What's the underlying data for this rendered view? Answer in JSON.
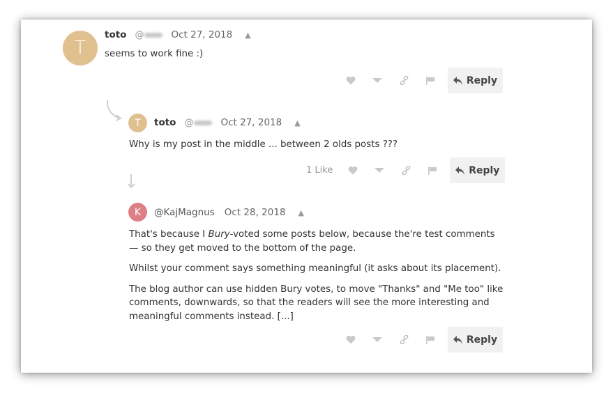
{
  "comments": [
    {
      "avatar_letter": "T",
      "avatar_color": "#e0c08f",
      "username": "toto",
      "handle_prefix": "@",
      "date": "Oct 27, 2018",
      "collapse_icon": "caret-up-icon",
      "body": [
        "seems to work fine :)"
      ],
      "likes": "",
      "reply_label": "Reply"
    },
    {
      "avatar_letter": "T",
      "avatar_color": "#e0c08f",
      "username": "toto",
      "handle_prefix": "@",
      "date": "Oct 27, 2018",
      "collapse_icon": "caret-up-icon",
      "body": [
        "Why is my post in the middle ... between 2 olds posts ???"
      ],
      "likes": "1 Like",
      "reply_label": "Reply"
    },
    {
      "avatar_letter": "K",
      "avatar_color": "#de7f85",
      "username": "@KajMagnus",
      "date": "Oct 28, 2018",
      "collapse_icon": "caret-up-icon",
      "body_p1_before": "That's because I ",
      "body_p1_em": "Bury",
      "body_p1_after": "-voted some posts below, because the're test comments — so they get moved to the bottom of the page.",
      "body_p2": "Whilst your comment says something meaningful (it asks about its placement).",
      "body_p3": "The blog author can use hidden Bury votes, to move \"Thanks\" and \"Me too\" like comments, downwards, so that the readers will see the more interesting and meaningful comments instead. [...]",
      "likes": "",
      "reply_label": "Reply"
    }
  ],
  "action_icons": [
    "heart-icon",
    "downvote-icon",
    "link-icon",
    "flag-icon",
    "reply-arrow-icon"
  ],
  "colors": {
    "icon_gray": "#c9c9c9",
    "reply_bg": "#f1f1f1"
  }
}
